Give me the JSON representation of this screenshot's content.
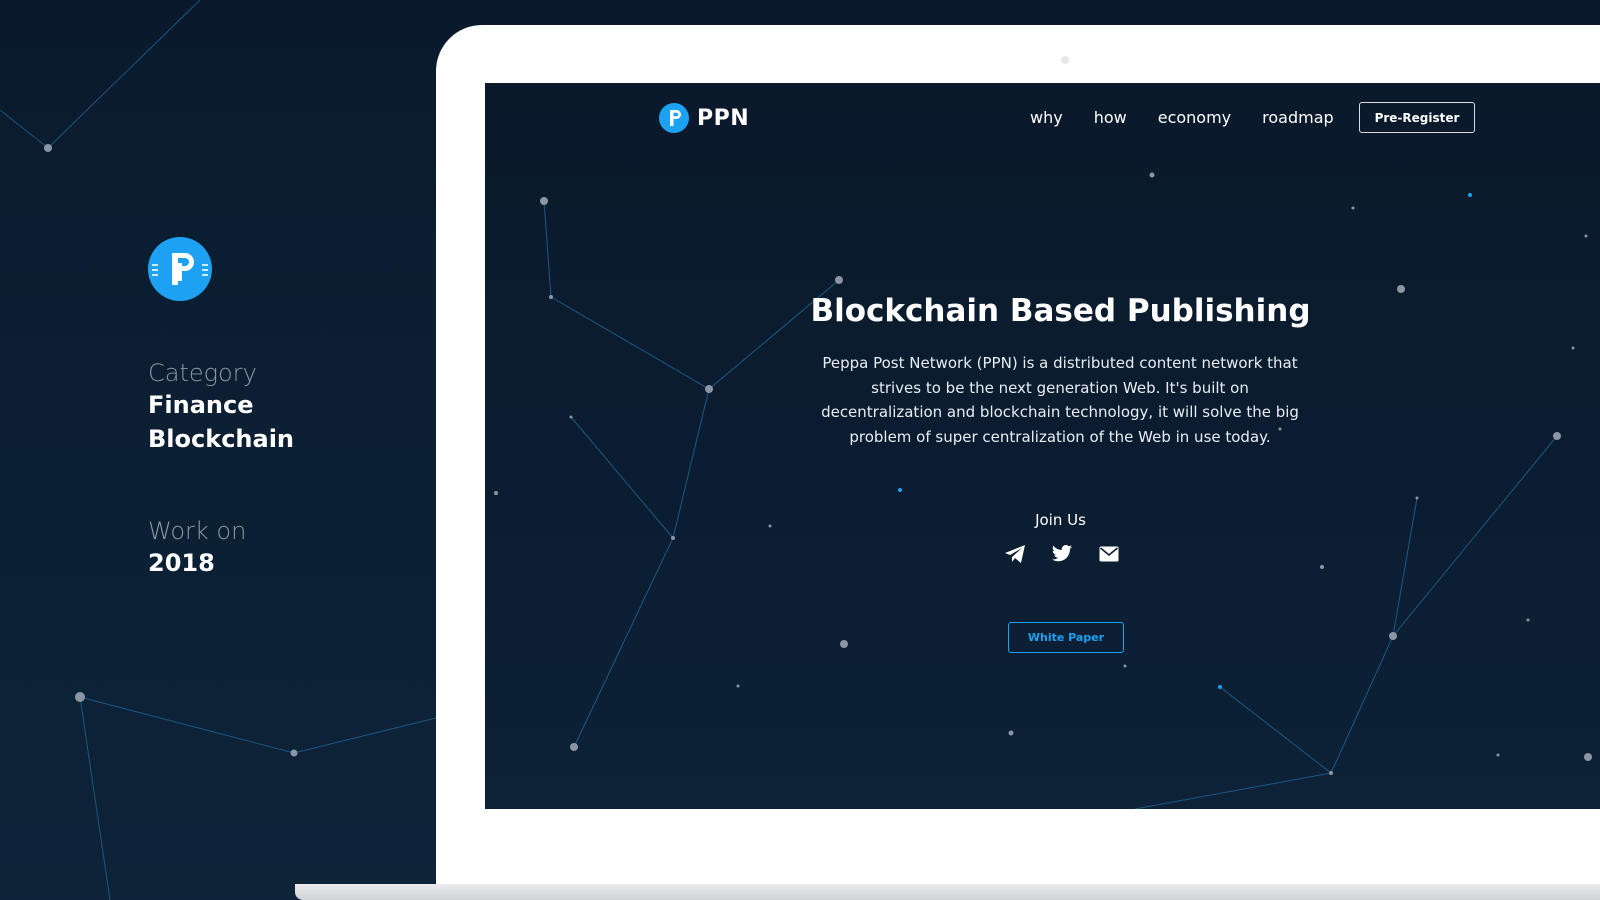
{
  "left_panel": {
    "category_label": "Category",
    "category_values": [
      "Finance",
      "Blockchain"
    ],
    "work_label": "Work on",
    "work_year": "2018"
  },
  "site": {
    "brand": "PPN",
    "nav": [
      "why",
      "how",
      "economy",
      "roadmap"
    ],
    "cta": "Pre-Register",
    "hero": {
      "title": "Blockchain Based Publishing",
      "description": "Peppa Post Network (PPN) is a distributed content network that strives to be the next generation Web. It's built on decentralization and blockchain technology, it will solve the big problem of super centralization of the Web in use today."
    },
    "join_label": "Join Us",
    "social_icons": [
      "telegram-icon",
      "twitter-icon",
      "mail-icon"
    ],
    "white_paper": "White Paper"
  },
  "colors": {
    "background": "#0b1d30",
    "accent": "#1da1f2",
    "laptop_frame": "#ffffff"
  }
}
